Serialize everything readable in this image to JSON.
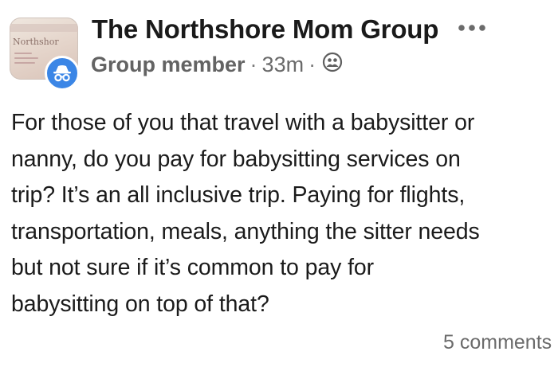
{
  "post": {
    "group_name": "The Northshore Mom Group",
    "author_role": "Group member",
    "separator": "·",
    "time_ago": "33m",
    "audience_icon": "group-audience-icon",
    "more_icon": "more-options-icon",
    "thumbnail_text": "Northshor",
    "body_lines": [
      "For those of you that travel with a babysitter or",
      "nanny, do you pay for babysitting services on",
      "trip? It’s an all inclusive trip. Paying for flights,",
      "transportation, meals, anything the sitter needs",
      "but not sure if it’s common to pay for",
      "babysitting on top of that?"
    ],
    "comments_label": "5 comments"
  },
  "colors": {
    "anonymous_badge": "#3b86e6",
    "text_primary": "#1b1b1b",
    "text_secondary": "#6a6a6a"
  }
}
